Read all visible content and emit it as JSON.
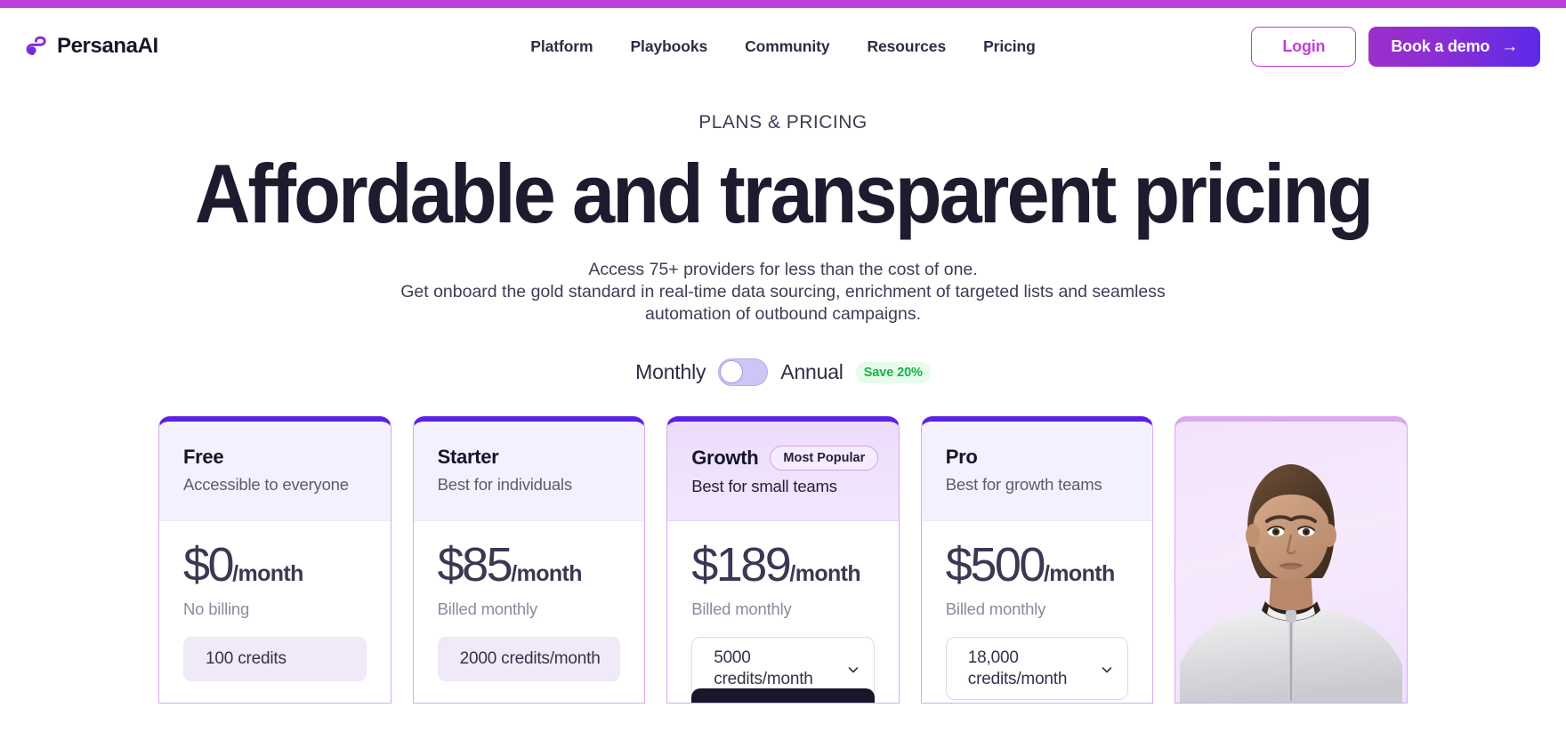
{
  "theme": {
    "top_bar_color": "#c03edb",
    "brand_purple": "#5b21e6",
    "accent_magenta": "#c03edb",
    "save_green": "#18b348",
    "card_border": "#d9a8ef"
  },
  "nav": {
    "brand_name": "PersanaAI",
    "links": [
      {
        "label": "Platform"
      },
      {
        "label": "Playbooks"
      },
      {
        "label": "Community"
      },
      {
        "label": "Resources"
      },
      {
        "label": "Pricing"
      }
    ],
    "login_label": "Login",
    "demo_label": "Book a demo",
    "demo_arrow": "→"
  },
  "hero": {
    "eyebrow": "PLANS & PRICING",
    "headline": "Affordable and transparent pricing",
    "sub_line_1": "Access 75+ providers for less than the cost of one.",
    "sub_line_2": "Get onboard the gold standard in real-time data sourcing, enrichment of targeted lists and seamless automation of outbound campaigns."
  },
  "billing_toggle": {
    "monthly_label": "Monthly",
    "annual_label": "Annual",
    "save_badge": "Save 20%",
    "selected": "Monthly",
    "knob_position": "left"
  },
  "plans": [
    {
      "name": "Free",
      "badge": null,
      "description": "Accessible to everyone",
      "price_amount": "$0",
      "price_period": "/month",
      "billing_note": "No billing",
      "credits_label": "100 credits",
      "credits_control": "pill",
      "cta_visible": false
    },
    {
      "name": "Starter",
      "badge": null,
      "description": "Best for individuals",
      "price_amount": "$85",
      "price_period": "/month",
      "billing_note": "Billed monthly",
      "credits_label": "2000 credits/month",
      "credits_control": "pill",
      "cta_visible": false
    },
    {
      "name": "Growth",
      "badge": "Most Popular",
      "description": "Best for small teams",
      "price_amount": "$189",
      "price_period": "/month",
      "billing_note": "Billed monthly",
      "credits_label": "5000 credits/month",
      "credits_control": "select",
      "cta_visible": true
    },
    {
      "name": "Pro",
      "badge": null,
      "description": "Best for growth teams",
      "price_amount": "$500",
      "price_period": "/month",
      "billing_note": "Billed monthly",
      "credits_label": "18,000 credits/month",
      "credits_control": "select",
      "cta_visible": false
    }
  ],
  "showcase_card": {
    "image_alt": "portrait of a woman in a white zip-collar top"
  }
}
